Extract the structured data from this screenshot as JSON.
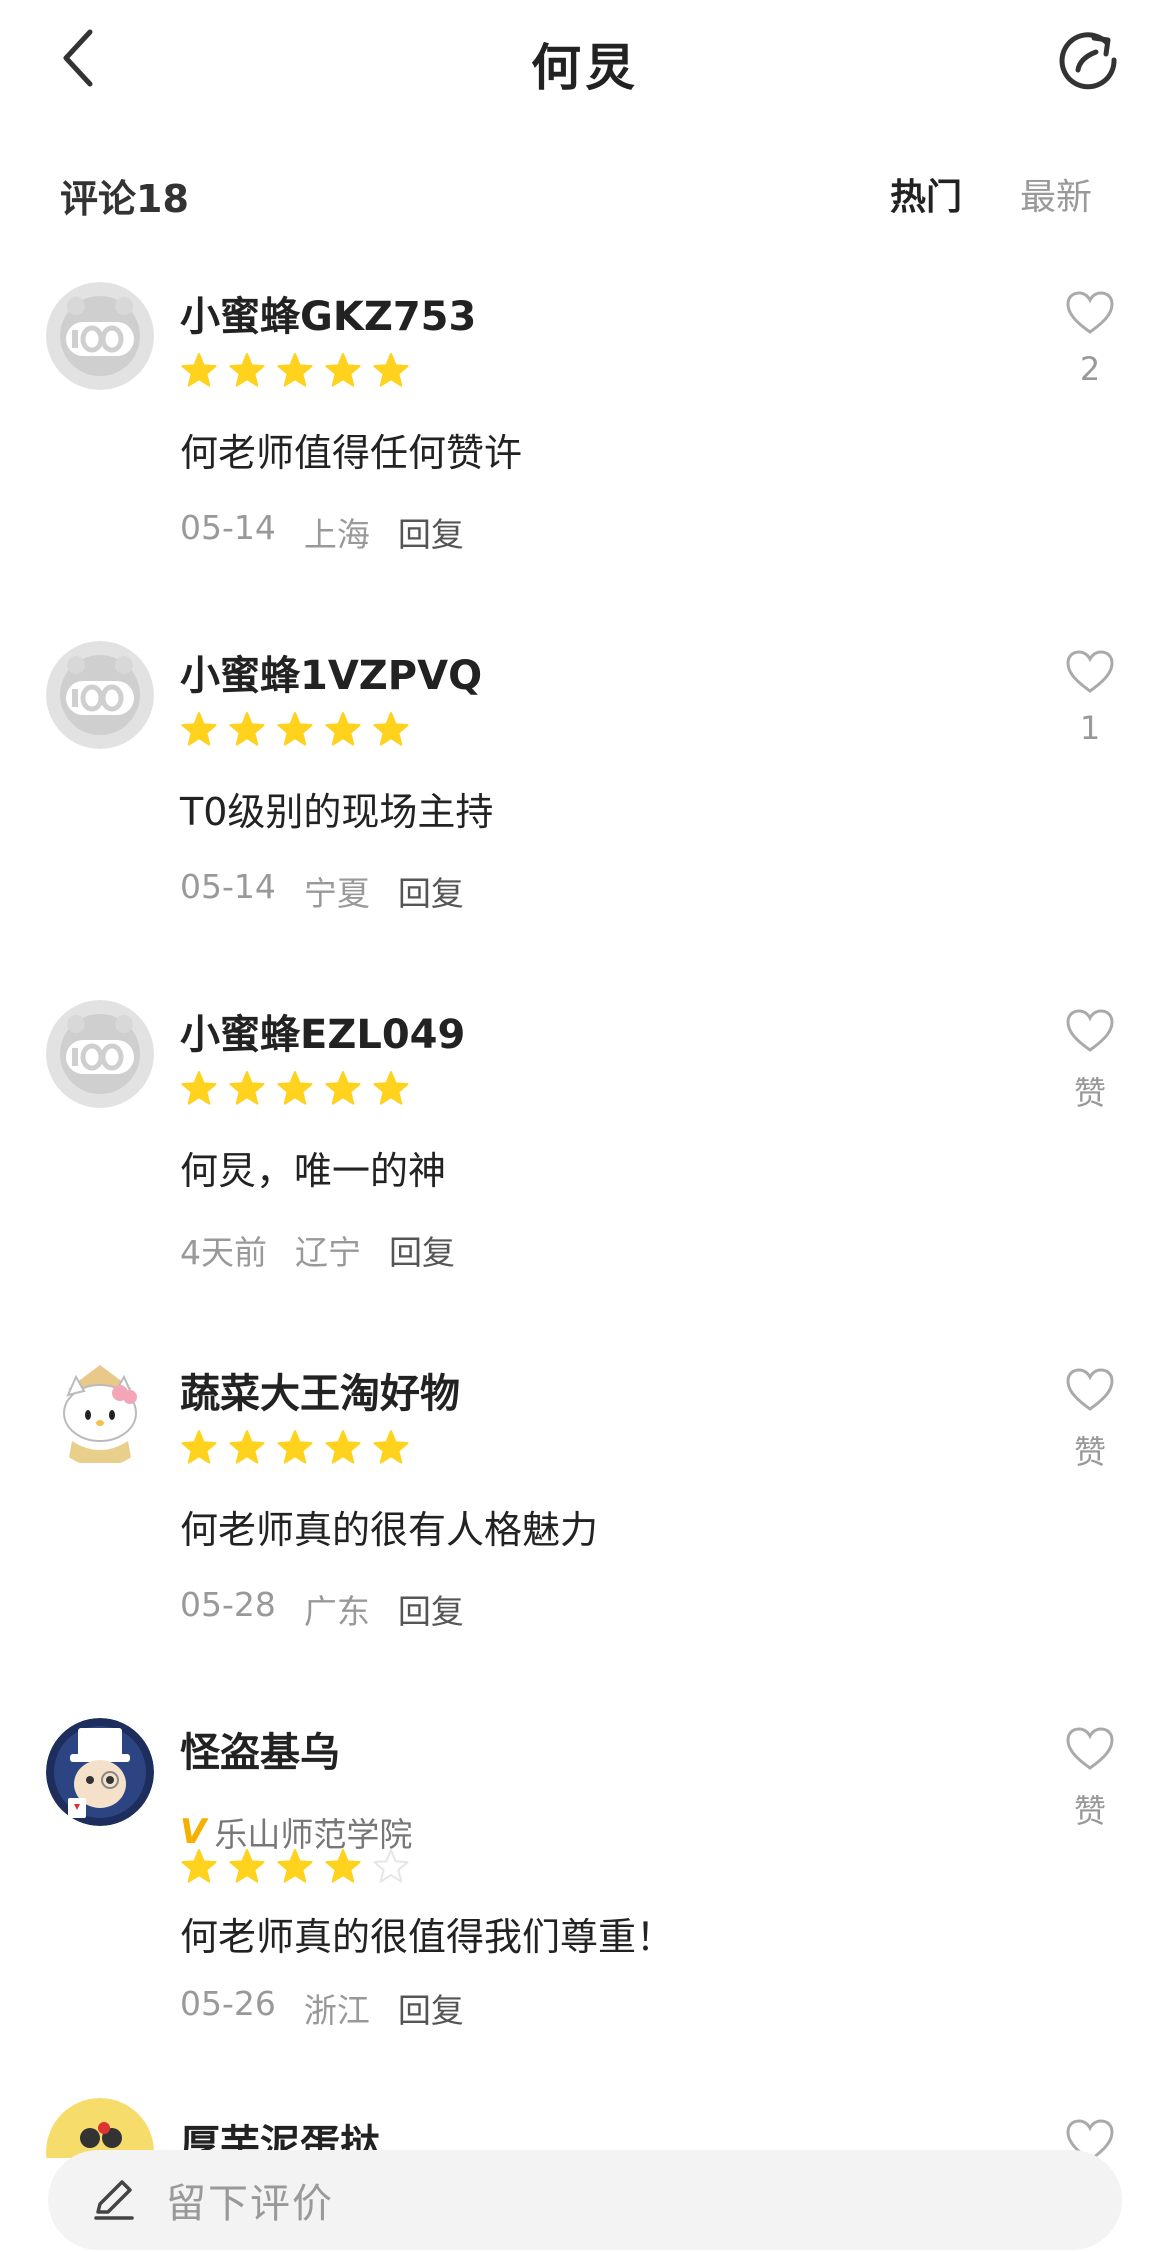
{
  "header": {
    "title": "何炅",
    "back_icon": "chevron-left-icon",
    "share_icon": "share-refresh-icon"
  },
  "comments_bar": {
    "count_label": "评论18",
    "sort_hot": "热门",
    "sort_new": "最新"
  },
  "colors": {
    "star_filled": "#FFD21E",
    "star_empty": "#E6E6E6",
    "verified_v": "#F6B100",
    "text_muted": "#999999"
  },
  "comments": [
    {
      "username": "小蜜蜂GKZ753",
      "rating": 5,
      "text": "何老师值得任何赞许",
      "date": "05-14",
      "location": "上海",
      "reply": "回复",
      "likes": "2",
      "avatar": "default-avatar"
    },
    {
      "username": "小蜜蜂1VZPVQ",
      "rating": 5,
      "text": "T0级别的现场主持",
      "date": "05-14",
      "location": "宁夏",
      "reply": "回复",
      "likes": "1",
      "avatar": "default-avatar"
    },
    {
      "username": "小蜜蜂EZL049",
      "rating": 5,
      "text": "何炅，唯一的神",
      "date": "4天前",
      "location": "辽宁",
      "reply": "回复",
      "likes": "赞",
      "avatar": "default-avatar"
    },
    {
      "username": "蔬菜大王淘好物",
      "rating": 5,
      "text": "何老师真的很有人格魅力",
      "date": "05-28",
      "location": "广东",
      "reply": "回复",
      "likes": "赞",
      "avatar": "hello-kitty-avatar"
    },
    {
      "username": "怪盗基乌",
      "verified_label": "乐山师范学院",
      "rating": 4,
      "text": "何老师真的很值得我们尊重！",
      "date": "05-26",
      "location": "浙江",
      "reply": "回复",
      "likes": "赞",
      "avatar": "kid-kaito-avatar"
    },
    {
      "username": "厚芋泥蛋挞",
      "avatar": "yellow-avatar"
    }
  ],
  "bottom_bar": {
    "placeholder": "留下评价",
    "icon": "pen-icon"
  }
}
